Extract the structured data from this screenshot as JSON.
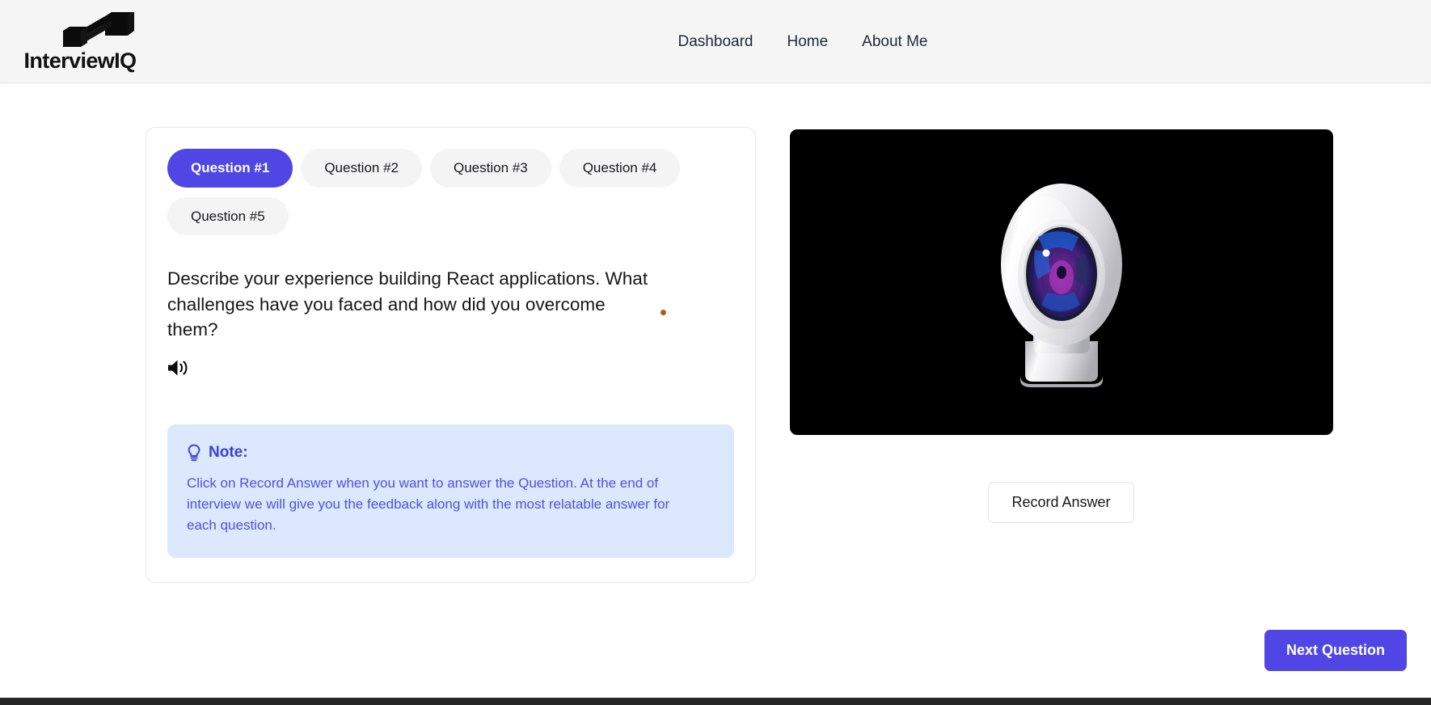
{
  "header": {
    "brand_name": "InterviewIQ",
    "logo_icon": "isometric-cubes-logo",
    "nav": [
      {
        "label": "Dashboard",
        "name": "nav-link-dashboard"
      },
      {
        "label": "Home",
        "name": "nav-link-home"
      },
      {
        "label": "About Me",
        "name": "nav-link-about-me"
      }
    ]
  },
  "question_panel": {
    "tabs": [
      {
        "label": "Question #1",
        "active": true
      },
      {
        "label": "Question #2",
        "active": false
      },
      {
        "label": "Question #3",
        "active": false
      },
      {
        "label": "Question #4",
        "active": false
      },
      {
        "label": "Question #5",
        "active": false
      }
    ],
    "question_text": "Describe your experience building React applications. What challenges have you faced and how did you overcome them?",
    "speaker_icon": "volume-speaker-icon",
    "status_dot_color": "#b35c0d",
    "note": {
      "icon": "lightbulb-icon",
      "title": "Note:",
      "body": "Click on Record Answer when you want to answer the Question. At the end of interview we will give you the feedback along with the most relatable answer for each question."
    }
  },
  "recorder": {
    "webcam_placeholder_icon": "webcam-icon",
    "record_label": "Record Answer"
  },
  "footer": {
    "next_label": "Next Question"
  },
  "colors": {
    "accent": "#4f46e5",
    "note_bg": "#dbe8fd",
    "note_text": "#4f52e0",
    "tab_bg": "#f4f4f5",
    "header_bg": "#f5f5f5"
  }
}
